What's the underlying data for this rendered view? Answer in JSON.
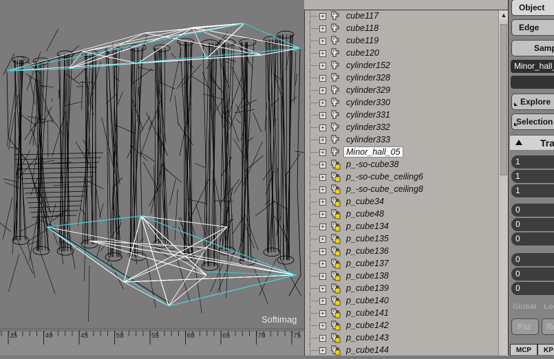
{
  "viewport": {
    "overlay_label": "Softimag"
  },
  "timeline": {
    "ticks": [
      "35",
      "40",
      "45",
      "50",
      "55",
      "60",
      "65",
      "70",
      "75"
    ]
  },
  "explorer": {
    "items": [
      {
        "label": "cube117",
        "icon": "mesh-object-icon"
      },
      {
        "label": "cube118",
        "icon": "mesh-object-icon"
      },
      {
        "label": "cube119",
        "icon": "mesh-object-icon"
      },
      {
        "label": "cube120",
        "icon": "mesh-object-icon"
      },
      {
        "label": "cylinder152",
        "icon": "mesh-object-icon"
      },
      {
        "label": "cylinder328",
        "icon": "mesh-object-icon"
      },
      {
        "label": "cylinder329",
        "icon": "mesh-object-icon"
      },
      {
        "label": "cylinder330",
        "icon": "mesh-object-icon"
      },
      {
        "label": "cylinder331",
        "icon": "mesh-object-icon"
      },
      {
        "label": "cylinder332",
        "icon": "mesh-object-icon"
      },
      {
        "label": "cylinder333",
        "icon": "mesh-object-icon"
      },
      {
        "label": "Minor_hall_05",
        "icon": "mesh-object-icon",
        "selected": true
      },
      {
        "label": "p_-so-cube38",
        "icon": "locked-object-icon"
      },
      {
        "label": "p_-so-cube_ceiling6",
        "icon": "locked-object-icon"
      },
      {
        "label": "p_-so-cube_ceiling8",
        "icon": "locked-object-icon"
      },
      {
        "label": "p_cube34",
        "icon": "locked-object-icon"
      },
      {
        "label": "p_cube48",
        "icon": "locked-object-icon"
      },
      {
        "label": "p_cube134",
        "icon": "locked-object-icon"
      },
      {
        "label": "p_cube135",
        "icon": "locked-object-icon"
      },
      {
        "label": "p_cube136",
        "icon": "locked-object-icon"
      },
      {
        "label": "p_cube137",
        "icon": "locked-object-icon"
      },
      {
        "label": "p_cube138",
        "icon": "locked-object-icon"
      },
      {
        "label": "p_cube139",
        "icon": "locked-object-icon"
      },
      {
        "label": "p_cube140",
        "icon": "locked-object-icon"
      },
      {
        "label": "p_cube141",
        "icon": "locked-object-icon"
      },
      {
        "label": "p_cube142",
        "icon": "locked-object-icon"
      },
      {
        "label": "p_cube143",
        "icon": "locked-object-icon"
      },
      {
        "label": "p_cube144",
        "icon": "locked-object-icon"
      }
    ]
  },
  "panel": {
    "object_label": "Object",
    "edge_label": "Edge",
    "sample_label": "Samp",
    "name_field": "Minor_hall_",
    "explore_label": "Explore",
    "selection_label": "Selection",
    "transform_header": "Tra",
    "scale_values": [
      "1",
      "1",
      "1"
    ],
    "rotate_values": [
      "0",
      "0",
      "0"
    ],
    "translate_values": [
      "0",
      "0",
      "0"
    ],
    "global_label": "Global",
    "local_label": "Loc",
    "par_label": "Par",
    "ref_label": "Re",
    "mcp_label": "MCP",
    "kp_label": "KP"
  },
  "colors": {
    "explorer_bg": "#b4b0ac",
    "viewport_bg": "#7b7b7b",
    "selection_cyan": "#3fd0d8",
    "wire_black": "#000000"
  }
}
